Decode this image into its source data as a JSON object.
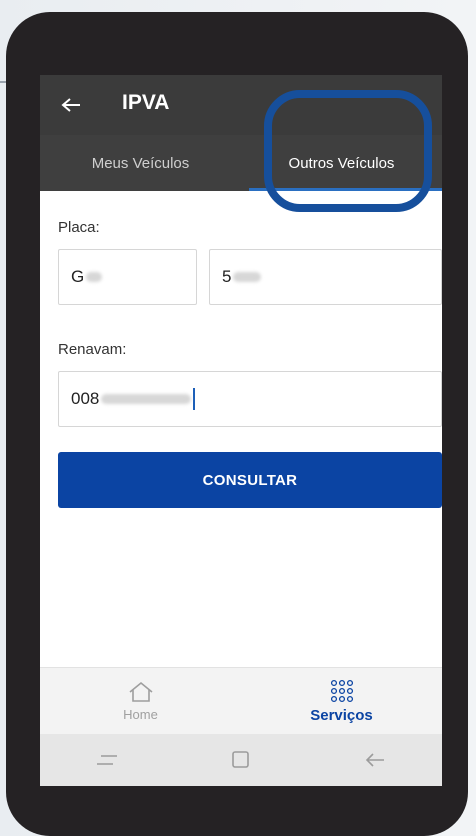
{
  "app": {
    "title": "IPVA"
  },
  "tabs": [
    {
      "label": "Meus Veículos",
      "active": false
    },
    {
      "label": "Outros Veículos",
      "active": true
    }
  ],
  "form": {
    "placa_label": "Placa:",
    "placa_letters": "G",
    "placa_numbers": "5",
    "renavam_label": "Renavam:",
    "renavam_value": "008",
    "submit_label": "CONSULTAR"
  },
  "bottom_nav": [
    {
      "label": "Home",
      "icon": "home-icon",
      "active": false
    },
    {
      "label": "Serviços",
      "icon": "grid-icon",
      "active": true
    }
  ],
  "colors": {
    "appbar": "#3b3b3b",
    "accent": "#0b44a3",
    "highlight_ring": "#164f9c",
    "background": "#2b77a8"
  }
}
